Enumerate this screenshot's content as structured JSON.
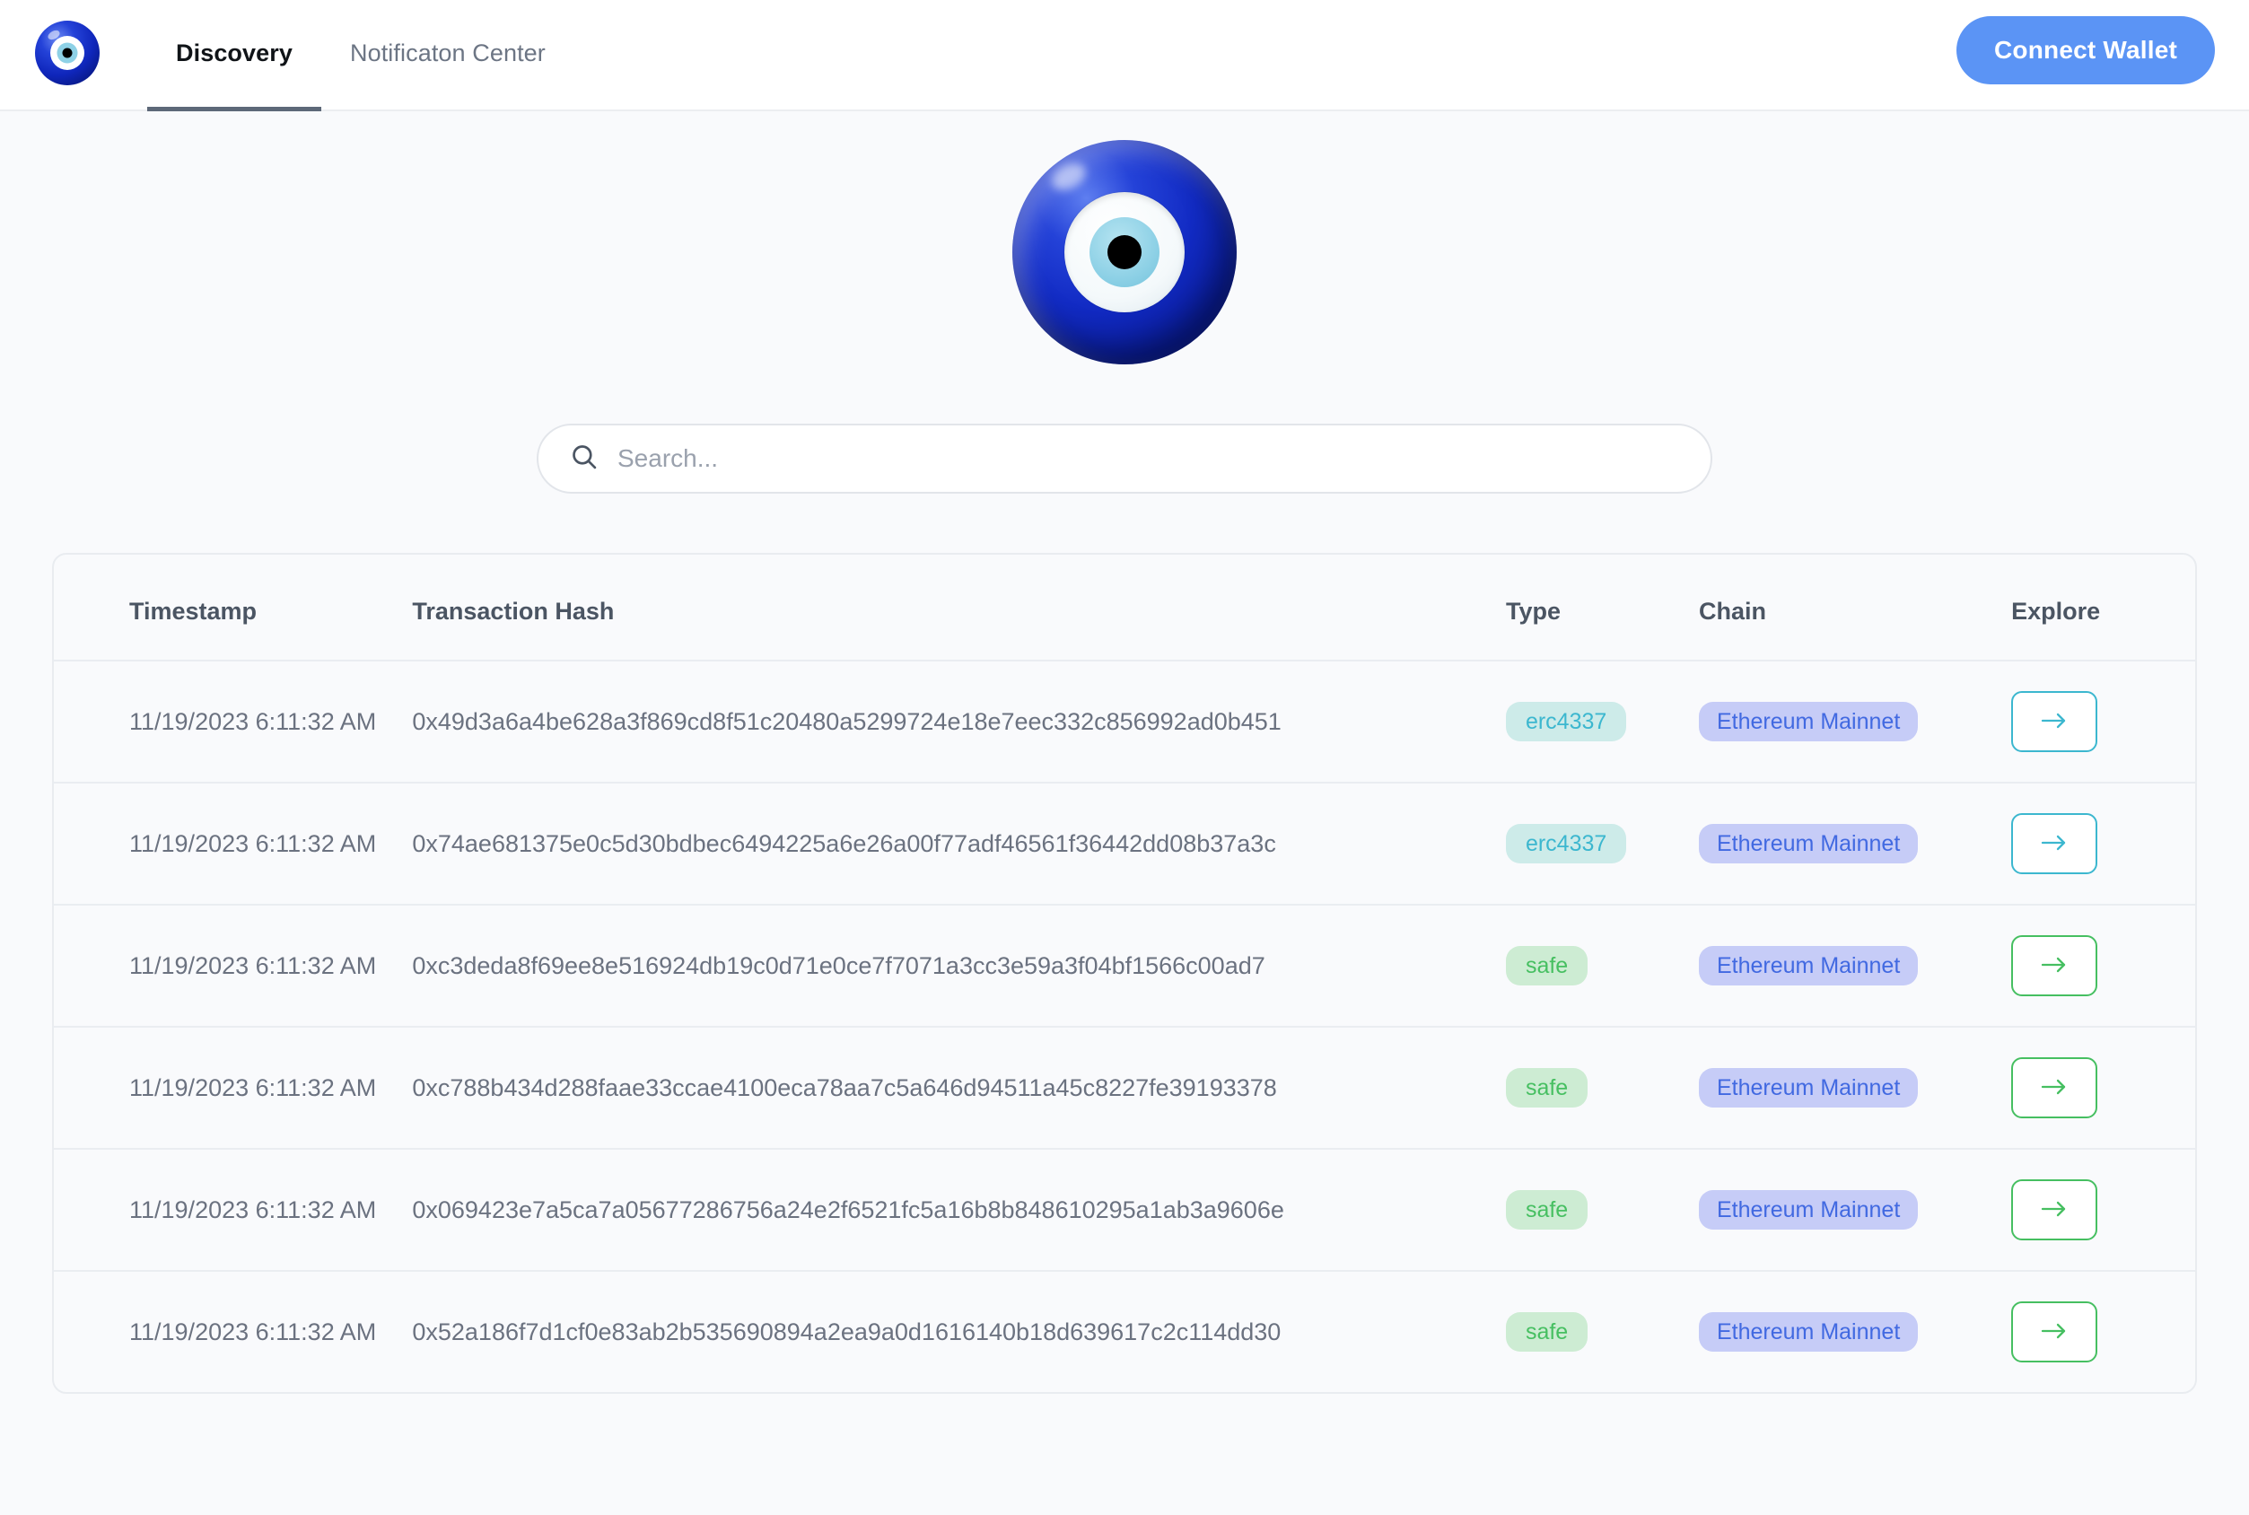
{
  "header": {
    "logo_icon": "nazar-eye-logo",
    "tabs": [
      {
        "label": "Discovery",
        "active": true
      },
      {
        "label": "Notificaton Center",
        "active": false
      }
    ],
    "connect_wallet_label": "Connect Wallet",
    "accent_color": "#5b94f5"
  },
  "hero": {
    "logo_icon": "nazar-eye-large",
    "colors": {
      "outer_ring": "#122bc4",
      "white_ring": "#ffffff",
      "iris": "#8ed1e6",
      "pupil": "#000000"
    }
  },
  "search": {
    "icon": "search-icon",
    "value": "",
    "placeholder": "Search..."
  },
  "table": {
    "columns": [
      "Timestamp",
      "Transaction Hash",
      "Type",
      "Chain",
      "Explore"
    ],
    "explore_arrow": "→",
    "type_colors": {
      "erc4337_bg": "#cdebe9",
      "erc4337_fg": "#3cb7cf",
      "safe_bg": "#cdecd3",
      "safe_fg": "#46bf61"
    },
    "chain_colors": {
      "bg": "#c6ccf7",
      "fg": "#4169e1"
    },
    "rows": [
      {
        "timestamp": "11/19/2023 6:11:32 AM",
        "hash": "0x49d3a6a4be628a3f869cd8f51c20480a5299724e18e7eec332c856992ad0b451",
        "type": "erc4337",
        "chain": "Ethereum Mainnet"
      },
      {
        "timestamp": "11/19/2023 6:11:32 AM",
        "hash": "0x74ae681375e0c5d30bdbec6494225a6e26a00f77adf46561f36442dd08b37a3c",
        "type": "erc4337",
        "chain": "Ethereum Mainnet"
      },
      {
        "timestamp": "11/19/2023 6:11:32 AM",
        "hash": "0xc3deda8f69ee8e516924db19c0d71e0ce7f7071a3cc3e59a3f04bf1566c00ad7",
        "type": "safe",
        "chain": "Ethereum Mainnet"
      },
      {
        "timestamp": "11/19/2023 6:11:32 AM",
        "hash": "0xc788b434d288faae33ccae4100eca78aa7c5a646d94511a45c8227fe39193378",
        "type": "safe",
        "chain": "Ethereum Mainnet"
      },
      {
        "timestamp": "11/19/2023 6:11:32 AM",
        "hash": "0x069423e7a5ca7a05677286756a24e2f6521fc5a16b8b848610295a1ab3a9606e",
        "type": "safe",
        "chain": "Ethereum Mainnet"
      },
      {
        "timestamp": "11/19/2023 6:11:32 AM",
        "hash": "0x52a186f7d1cf0e83ab2b535690894a2ea9a0d1616140b18d639617c2c114dd30",
        "type": "safe",
        "chain": "Ethereum Mainnet"
      }
    ]
  }
}
